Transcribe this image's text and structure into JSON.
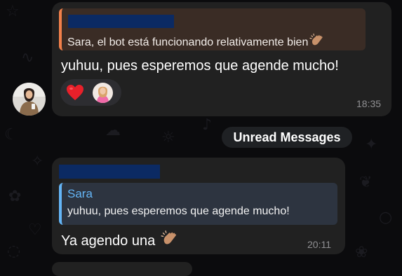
{
  "messages": [
    {
      "reply": {
        "text": "Sara, el bot está funcionando relativamente bien",
        "emoji_icon": "clapping-hands-icon",
        "accent": "#f2804a"
      },
      "text": "yuhuu, pues esperemos que agende mucho!",
      "reactions": [
        {
          "icon": "red-heart-icon"
        },
        {
          "icon": "reactor-avatar"
        }
      ],
      "time": "18:35"
    },
    {
      "reply": {
        "name": "Sara",
        "text": "yuhuu, pues esperemos que agende mucho!",
        "accent": "#64b5f6"
      },
      "text": "Ya agendo una",
      "emoji_icon": "clapping-hands-icon",
      "time": "20:11"
    }
  ],
  "unread": {
    "label": "Unread Messages"
  },
  "colors": {
    "background": "#0b0b0d",
    "bubble": "#212121",
    "reply_accent_orange": "#f2804a",
    "reply_accent_blue": "#64b5f6",
    "redaction": "#0b2a63"
  }
}
